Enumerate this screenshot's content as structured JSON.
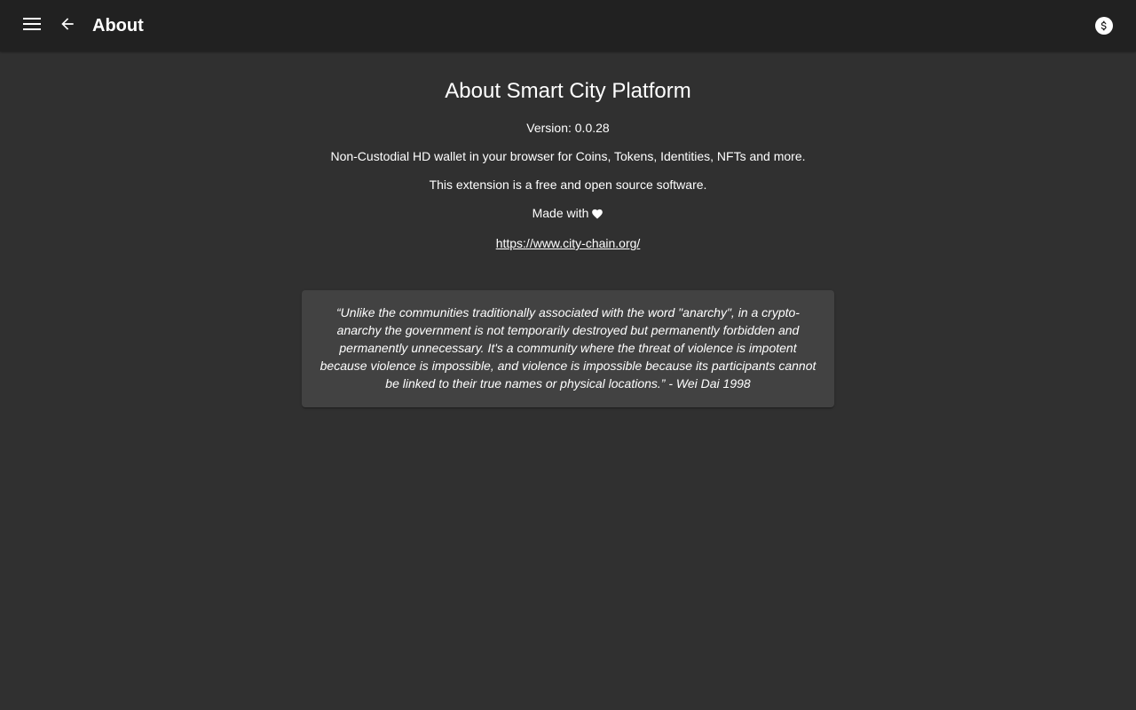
{
  "toolbar": {
    "title": "About",
    "menu_icon": "hamburger-menu-icon",
    "back_icon": "arrow-back-icon",
    "account_icon": "dollar-coin-icon"
  },
  "main": {
    "heading": "About Smart City Platform",
    "version": "Version: 0.0.28",
    "description": "Non-Custodial HD wallet in your browser for Coins, Tokens, Identities, NFTs and more.",
    "license_note": "This extension is a free and open source software.",
    "made_with": "Made with",
    "heart_icon": "heart-icon",
    "link": "https://www.city-chain.org/"
  },
  "quote": {
    "text": "“Unlike the communities traditionally associated with the word \"anarchy\", in a crypto-anarchy the government is not temporarily destroyed but permanently forbidden and permanently unnecessary. It's a community where the threat of violence is impotent because violence is impossible, and violence is impossible because its participants cannot be linked to their true names or physical locations.” - Wei Dai 1998"
  },
  "colors": {
    "toolbar_bg": "#212121",
    "page_bg": "#303030",
    "card_bg": "#424242",
    "text": "#ffffff"
  }
}
